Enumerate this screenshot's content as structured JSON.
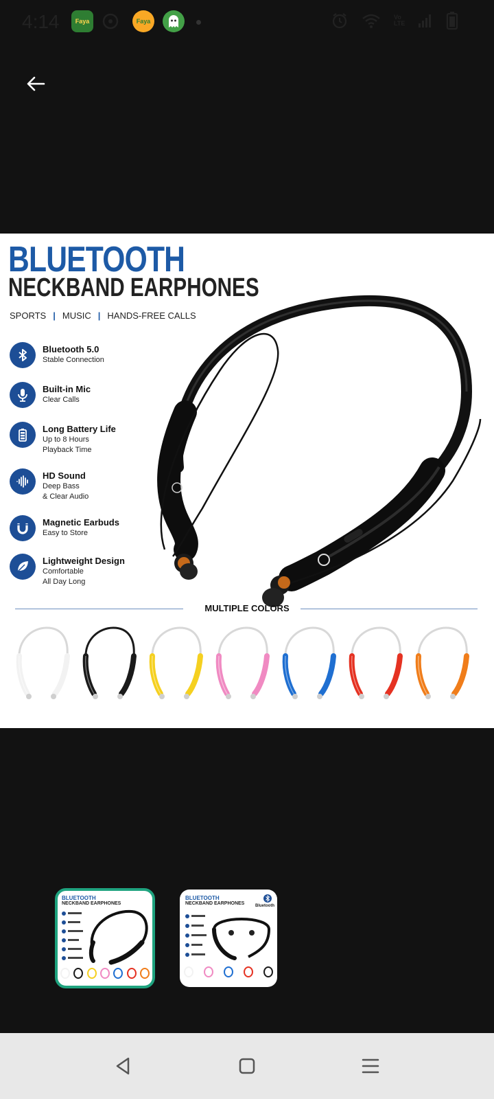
{
  "status": {
    "time": "4:14",
    "app1_label": "Faya",
    "app2_label": "Faya",
    "network_label": "Vo LTE"
  },
  "product": {
    "title_line1": "BLUETOOTH",
    "title_line2": "NECKBAND EARPHONES",
    "tags": [
      "SPORTS",
      "MUSIC",
      "HANDS-FREE CALLS"
    ],
    "features": [
      {
        "title": "Bluetooth 5.0",
        "sub1": "Stable Connection",
        "sub2": "",
        "icon": "bluetooth-icon"
      },
      {
        "title": "Built-in Mic",
        "sub1": "Clear Calls",
        "sub2": "",
        "icon": "microphone-icon"
      },
      {
        "title": "Long Battery Life",
        "sub1": "Up to 8 Hours",
        "sub2": "Playback Time",
        "icon": "battery-icon"
      },
      {
        "title": "HD Sound",
        "sub1": "Deep Bass",
        "sub2": "& Clear Audio",
        "icon": "sound-wave-icon"
      },
      {
        "title": "Magnetic Earbuds",
        "sub1": "Easy to Store",
        "sub2": "",
        "icon": "magnet-icon"
      },
      {
        "title": "Lightweight Design",
        "sub1": "Comfortable",
        "sub2": "All Day Long",
        "icon": "leaf-icon"
      }
    ],
    "colors_label": "MULTIPLE COLORS",
    "colors": [
      "#f2f2f2",
      "#1a1a1a",
      "#f5d020",
      "#f08ac2",
      "#1f6fd1",
      "#e53222",
      "#f07d1a"
    ]
  },
  "thumbnails": {
    "thumb1_title": "BLUETOOTH",
    "thumb1_sub": "NECKBAND EARPHONES",
    "thumb2_title": "BLUETOOTH",
    "thumb2_sub": "NECKBAND EARPHONES",
    "thumb2_badge": "Bluetooth"
  },
  "accent": "#1fa37f"
}
